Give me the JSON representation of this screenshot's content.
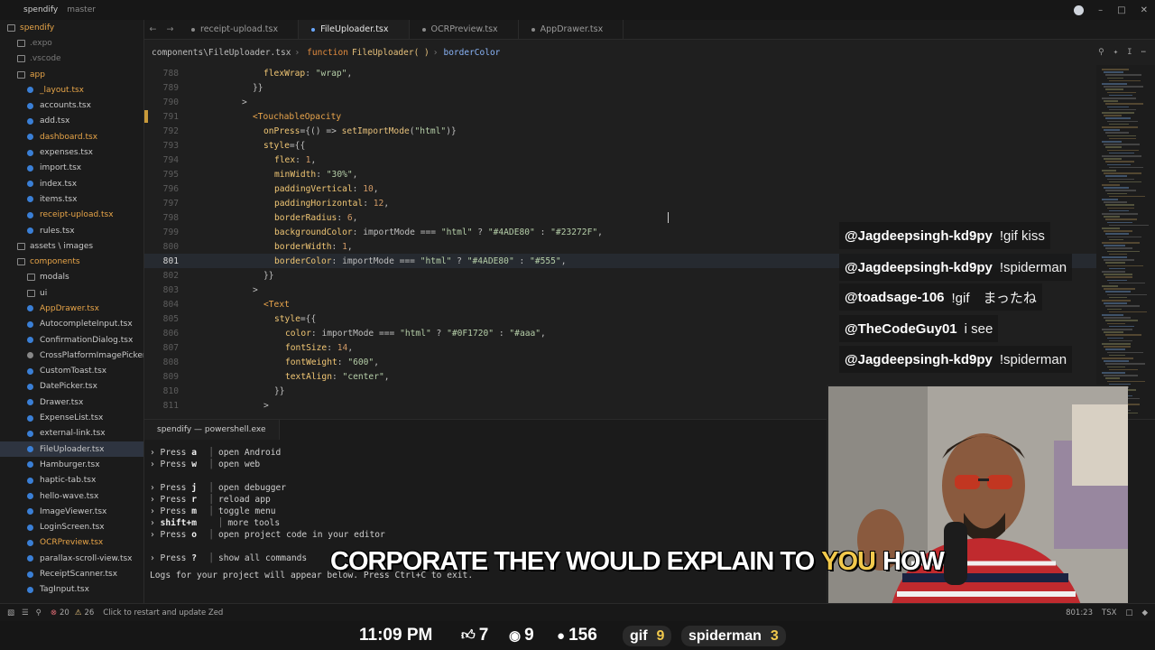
{
  "titlebar": {
    "project": "spendify",
    "branch": "master"
  },
  "sidebar": {
    "items": [
      {
        "label": "spendify",
        "kind": "folder",
        "depth": 0,
        "state": "mod"
      },
      {
        "label": ".expo",
        "kind": "folder",
        "depth": 1,
        "state": "dim"
      },
      {
        "label": ".vscode",
        "kind": "folder",
        "depth": 1,
        "state": "dim"
      },
      {
        "label": "app",
        "kind": "folder",
        "depth": 1,
        "state": "mod"
      },
      {
        "label": "_layout.tsx",
        "kind": "file",
        "depth": 2,
        "state": "mod"
      },
      {
        "label": "accounts.tsx",
        "kind": "file",
        "depth": 2,
        "state": ""
      },
      {
        "label": "add.tsx",
        "kind": "file",
        "depth": 2,
        "state": ""
      },
      {
        "label": "dashboard.tsx",
        "kind": "file",
        "depth": 2,
        "state": "mod"
      },
      {
        "label": "expenses.tsx",
        "kind": "file",
        "depth": 2,
        "state": ""
      },
      {
        "label": "import.tsx",
        "kind": "file",
        "depth": 2,
        "state": ""
      },
      {
        "label": "index.tsx",
        "kind": "file",
        "depth": 2,
        "state": ""
      },
      {
        "label": "items.tsx",
        "kind": "file",
        "depth": 2,
        "state": ""
      },
      {
        "label": "receipt-upload.tsx",
        "kind": "file",
        "depth": 2,
        "state": "mod"
      },
      {
        "label": "rules.tsx",
        "kind": "file",
        "depth": 2,
        "state": ""
      },
      {
        "label": "assets \\ images",
        "kind": "folder",
        "depth": 1,
        "state": ""
      },
      {
        "label": "components",
        "kind": "folder",
        "depth": 1,
        "state": "mod"
      },
      {
        "label": "modals",
        "kind": "folder",
        "depth": 2,
        "state": ""
      },
      {
        "label": "ui",
        "kind": "folder",
        "depth": 2,
        "state": ""
      },
      {
        "label": "AppDrawer.tsx",
        "kind": "file",
        "depth": 2,
        "state": "mod"
      },
      {
        "label": "AutocompleteInput.tsx",
        "kind": "file",
        "depth": 2,
        "state": ""
      },
      {
        "label": "ConfirmationDialog.tsx",
        "kind": "file",
        "depth": 2,
        "state": ""
      },
      {
        "label": "CrossPlatformImagePicker",
        "kind": "file",
        "depth": 2,
        "state": ""
      },
      {
        "label": "CustomToast.tsx",
        "kind": "file",
        "depth": 2,
        "state": ""
      },
      {
        "label": "DatePicker.tsx",
        "kind": "file",
        "depth": 2,
        "state": ""
      },
      {
        "label": "Drawer.tsx",
        "kind": "file",
        "depth": 2,
        "state": ""
      },
      {
        "label": "ExpenseList.tsx",
        "kind": "file",
        "depth": 2,
        "state": ""
      },
      {
        "label": "external-link.tsx",
        "kind": "file",
        "depth": 2,
        "state": ""
      },
      {
        "label": "FileUploader.tsx",
        "kind": "file",
        "depth": 2,
        "state": "selected"
      },
      {
        "label": "Hamburger.tsx",
        "kind": "file",
        "depth": 2,
        "state": ""
      },
      {
        "label": "haptic-tab.tsx",
        "kind": "file",
        "depth": 2,
        "state": ""
      },
      {
        "label": "hello-wave.tsx",
        "kind": "file",
        "depth": 2,
        "state": ""
      },
      {
        "label": "ImageViewer.tsx",
        "kind": "file",
        "depth": 2,
        "state": ""
      },
      {
        "label": "LoginScreen.tsx",
        "kind": "file",
        "depth": 2,
        "state": ""
      },
      {
        "label": "OCRPreview.tsx",
        "kind": "file",
        "depth": 2,
        "state": "mod"
      },
      {
        "label": "parallax-scroll-view.tsx",
        "kind": "file",
        "depth": 2,
        "state": ""
      },
      {
        "label": "ReceiptScanner.tsx",
        "kind": "file",
        "depth": 2,
        "state": ""
      },
      {
        "label": "TagInput.tsx",
        "kind": "file",
        "depth": 2,
        "state": ""
      }
    ]
  },
  "tabs": [
    {
      "label": "receipt-upload.tsx",
      "active": false
    },
    {
      "label": "FileUploader.tsx",
      "active": true
    },
    {
      "label": "OCRPreview.tsx",
      "active": false
    },
    {
      "label": "AppDrawer.tsx",
      "active": false
    }
  ],
  "breadcrumb": {
    "path": "components\\FileUploader.tsx",
    "keyword": "function",
    "fn": "FileUploader( )",
    "symbol": "borderColor"
  },
  "editor": {
    "current_line": 801,
    "lines": [
      {
        "n": 788,
        "indent": 6,
        "tokens": [
          [
            "flexWrap",
            "prop"
          ],
          [
            ": ",
            "punc"
          ],
          [
            "\"wrap\"",
            "str"
          ],
          [
            ",",
            "punc"
          ]
        ]
      },
      {
        "n": 789,
        "indent": 5,
        "tokens": [
          [
            "}}",
            "punc"
          ]
        ]
      },
      {
        "n": 790,
        "indent": 4,
        "tokens": [
          [
            ">",
            "punc"
          ]
        ]
      },
      {
        "n": 791,
        "indent": 5,
        "tokens": [
          [
            "<TouchableOpacity",
            "tag"
          ]
        ]
      },
      {
        "n": 792,
        "indent": 6,
        "tokens": [
          [
            "onPress",
            "prop"
          ],
          [
            "={() => ",
            "punc"
          ],
          [
            "setImportMode",
            "fn"
          ],
          [
            "(",
            "punc"
          ],
          [
            "\"html\"",
            "str"
          ],
          [
            ")}",
            "punc"
          ]
        ]
      },
      {
        "n": 793,
        "indent": 6,
        "tokens": [
          [
            "style",
            "prop"
          ],
          [
            "={{",
            "punc"
          ]
        ]
      },
      {
        "n": 794,
        "indent": 7,
        "tokens": [
          [
            "flex",
            "prop"
          ],
          [
            ": ",
            "punc"
          ],
          [
            "1",
            "num"
          ],
          [
            ",",
            "punc"
          ]
        ]
      },
      {
        "n": 795,
        "indent": 7,
        "tokens": [
          [
            "minWidth",
            "prop"
          ],
          [
            ": ",
            "punc"
          ],
          [
            "\"30%\"",
            "str"
          ],
          [
            ",",
            "punc"
          ]
        ]
      },
      {
        "n": 796,
        "indent": 7,
        "tokens": [
          [
            "paddingVertical",
            "prop"
          ],
          [
            ": ",
            "punc"
          ],
          [
            "10",
            "num"
          ],
          [
            ",",
            "punc"
          ]
        ]
      },
      {
        "n": 797,
        "indent": 7,
        "tokens": [
          [
            "paddingHorizontal",
            "prop"
          ],
          [
            ": ",
            "punc"
          ],
          [
            "12",
            "num"
          ],
          [
            ",",
            "punc"
          ]
        ]
      },
      {
        "n": 798,
        "indent": 7,
        "tokens": [
          [
            "borderRadius",
            "prop"
          ],
          [
            ": ",
            "punc"
          ],
          [
            "6",
            "num"
          ],
          [
            ",",
            "punc"
          ]
        ]
      },
      {
        "n": 799,
        "indent": 7,
        "tokens": [
          [
            "backgroundColor",
            "prop"
          ],
          [
            ": importMode === ",
            "punc"
          ],
          [
            "\"html\"",
            "str"
          ],
          [
            " ? ",
            "punc"
          ],
          [
            "\"#4ADE80\"",
            "str"
          ],
          [
            " : ",
            "punc"
          ],
          [
            "\"#23272F\"",
            "str"
          ],
          [
            ",",
            "punc"
          ]
        ]
      },
      {
        "n": 800,
        "indent": 7,
        "tokens": [
          [
            "borderWidth",
            "prop"
          ],
          [
            ": ",
            "punc"
          ],
          [
            "1",
            "num"
          ],
          [
            ",",
            "punc"
          ]
        ]
      },
      {
        "n": 801,
        "indent": 7,
        "tokens": [
          [
            "borderColor",
            "prop"
          ],
          [
            ": importMode === ",
            "punc"
          ],
          [
            "\"html\"",
            "str"
          ],
          [
            " ? ",
            "punc"
          ],
          [
            "\"#4ADE80\"",
            "str"
          ],
          [
            " : ",
            "punc"
          ],
          [
            "\"#555\"",
            "str"
          ],
          [
            ",",
            "punc"
          ]
        ]
      },
      {
        "n": 802,
        "indent": 6,
        "tokens": [
          [
            "}}",
            "punc"
          ]
        ]
      },
      {
        "n": 803,
        "indent": 5,
        "tokens": [
          [
            ">",
            "punc"
          ]
        ]
      },
      {
        "n": 804,
        "indent": 6,
        "tokens": [
          [
            "<Text",
            "tag"
          ]
        ]
      },
      {
        "n": 805,
        "indent": 7,
        "tokens": [
          [
            "style",
            "prop"
          ],
          [
            "={{",
            "punc"
          ]
        ]
      },
      {
        "n": 806,
        "indent": 8,
        "tokens": [
          [
            "color",
            "prop"
          ],
          [
            ": importMode === ",
            "punc"
          ],
          [
            "\"html\"",
            "str"
          ],
          [
            " ? ",
            "punc"
          ],
          [
            "\"#0F1720\"",
            "str"
          ],
          [
            " : ",
            "punc"
          ],
          [
            "\"#aaa\"",
            "str"
          ],
          [
            ",",
            "punc"
          ]
        ]
      },
      {
        "n": 807,
        "indent": 8,
        "tokens": [
          [
            "fontSize",
            "prop"
          ],
          [
            ": ",
            "punc"
          ],
          [
            "14",
            "num"
          ],
          [
            ",",
            "punc"
          ]
        ]
      },
      {
        "n": 808,
        "indent": 8,
        "tokens": [
          [
            "fontWeight",
            "prop"
          ],
          [
            ": ",
            "punc"
          ],
          [
            "\"600\"",
            "str"
          ],
          [
            ",",
            "punc"
          ]
        ]
      },
      {
        "n": 809,
        "indent": 8,
        "tokens": [
          [
            "textAlign",
            "prop"
          ],
          [
            ": ",
            "punc"
          ],
          [
            "\"center\"",
            "str"
          ],
          [
            ",",
            "punc"
          ]
        ]
      },
      {
        "n": 810,
        "indent": 7,
        "tokens": [
          [
            "}}",
            "punc"
          ]
        ]
      },
      {
        "n": 811,
        "indent": 6,
        "tokens": [
          [
            ">",
            "punc"
          ]
        ]
      }
    ]
  },
  "terminal": {
    "tab_label": "spendify — powershell.exe",
    "lines": [
      {
        "key": "a",
        "text": "open Android"
      },
      {
        "key": "w",
        "text": "open web"
      },
      {
        "key": "",
        "text": ""
      },
      {
        "key": "j",
        "text": "open debugger"
      },
      {
        "key": "r",
        "text": "reload app"
      },
      {
        "key": "m",
        "text": "toggle menu"
      },
      {
        "key": "shift+m",
        "text": "more tools"
      },
      {
        "key": "o",
        "text": "open project code in your editor"
      },
      {
        "key": "",
        "text": ""
      },
      {
        "key": "?",
        "text": "show all commands"
      }
    ],
    "log_line": "Logs for your project will appear below. Press Ctrl+C to exit."
  },
  "statusbar": {
    "errors": "20",
    "warnings": "26",
    "message": "Click to restart and update Zed",
    "position": "801:23",
    "language": "TSX"
  },
  "chat": [
    {
      "user": "@Jagdeepsingh-kd9py",
      "text": "!gif kiss"
    },
    {
      "user": "@Jagdeepsingh-kd9py",
      "text": "!spiderman"
    },
    {
      "user": "@toadsage-106",
      "text": "!gif　まったね"
    },
    {
      "user": "@TheCodeGuy01",
      "text": "i see"
    },
    {
      "user": "@Jagdeepsingh-kd9py",
      "text": "!spiderman"
    }
  ],
  "subtitle": {
    "before": "CORPORATE THEY WOULD EXPLAIN TO",
    "highlight": "YOU",
    "after": "HOW"
  },
  "stream_stats": {
    "time": "11:09 PM",
    "likes": "7",
    "viewers": "9",
    "messages": "156",
    "commands": [
      {
        "label": "gif",
        "count": "9"
      },
      {
        "label": "spiderman",
        "count": "3"
      }
    ]
  },
  "colors": {
    "accent": "#6aa7ff",
    "modified": "#e8a548",
    "highlight": "#f2c94c"
  },
  "icons": [
    "back-icon",
    "forward-icon",
    "search-icon",
    "gear-icon",
    "close-icon",
    "thumbs-up-icon",
    "eye-icon",
    "chat-bubble-icon"
  ]
}
